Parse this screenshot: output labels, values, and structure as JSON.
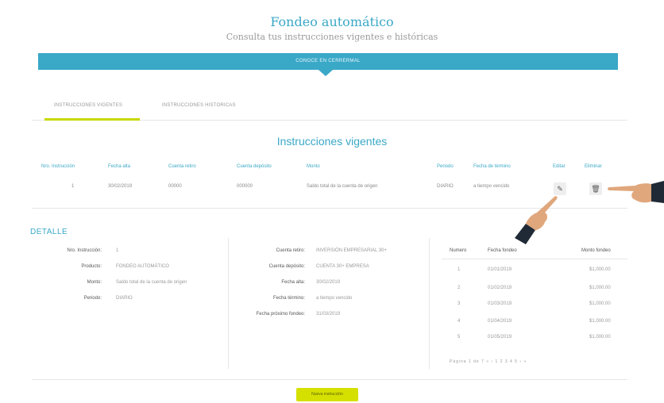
{
  "header": {
    "title": "Fondeo automático",
    "subtitle": "Consulta tus instrucciones vigentes e históricas"
  },
  "banner": {
    "label": "CONOCE EN CERRERMAL"
  },
  "tabs": [
    {
      "label": "INSTRUCCIONES VIGENTES",
      "active": true
    },
    {
      "label": "INSTRUCCIONES HISTORICAS",
      "active": false
    }
  ],
  "current": {
    "title": "Instrucciones vigentes",
    "columns": [
      "Nro. Instrucción",
      "Fecha alta",
      "Cuenta retiro",
      "Cuenta depósito",
      "Monto",
      "Periodo",
      "Fecha de término",
      "Editar",
      "Eliminar"
    ],
    "row": {
      "nro": "1",
      "fecha_alta": "30/02/2019",
      "cuenta_retiro": "00000",
      "cuenta_deposito": "000000",
      "monto": "Saldo total de la cuenta de origen",
      "periodo": "DIARIO",
      "fecha_termino": "a tiempo vencido"
    }
  },
  "detail": {
    "title": "DETALLE",
    "col1": {
      "nro_label": "Nro. Instrucción:",
      "nro_value": "1",
      "producto_label": "Producto:",
      "producto_value": "FONDEO AUTOMÁTICO",
      "monto_label": "Monto:",
      "monto_value": "Saldo total de la cuenta de origen",
      "periodo_label": "Periodo:",
      "periodo_value": "DIARIO"
    },
    "col2": {
      "retiro_label": "Cuenta retiro:",
      "retiro_value": "INVERSIÓN EMPRESARIAL 30+",
      "deposito_label": "Cuenta depósito:",
      "deposito_value": "CUENTA 30+ EMPRESA",
      "alta_label": "Fecha alta:",
      "alta_value": "30/02/2019",
      "termino_label": "Fecha término:",
      "termino_value": "a tiempo vencido",
      "proximo_label": "Fecha próximo fondeo:",
      "proximo_value": "31/03/2019"
    },
    "schedule": {
      "headers": [
        "Numero",
        "Fecha fondeo",
        "Monto fondeo"
      ],
      "rows": [
        {
          "n": "1",
          "fecha": "01/01/2019",
          "monto": "$1,000.00"
        },
        {
          "n": "2",
          "fecha": "01/02/2019",
          "monto": "$1,000.00"
        },
        {
          "n": "3",
          "fecha": "01/03/2019",
          "monto": "$1,000.00"
        },
        {
          "n": "4",
          "fecha": "01/04/2019",
          "monto": "$1,000.00"
        },
        {
          "n": "5",
          "fecha": "01/05/2019",
          "monto": "$1,000.00"
        }
      ],
      "pager": "Página 1 de 7   «   ‹   1   2   3   4   5   ›   »"
    }
  },
  "actions": {
    "new_label": "Nueva instrucción"
  },
  "icons": {
    "edit": "pencil-icon",
    "delete": "trash-icon",
    "hand": "pointing-hand-icon"
  },
  "colors": {
    "accent": "#3aa8c7",
    "button": "#d6e000"
  }
}
